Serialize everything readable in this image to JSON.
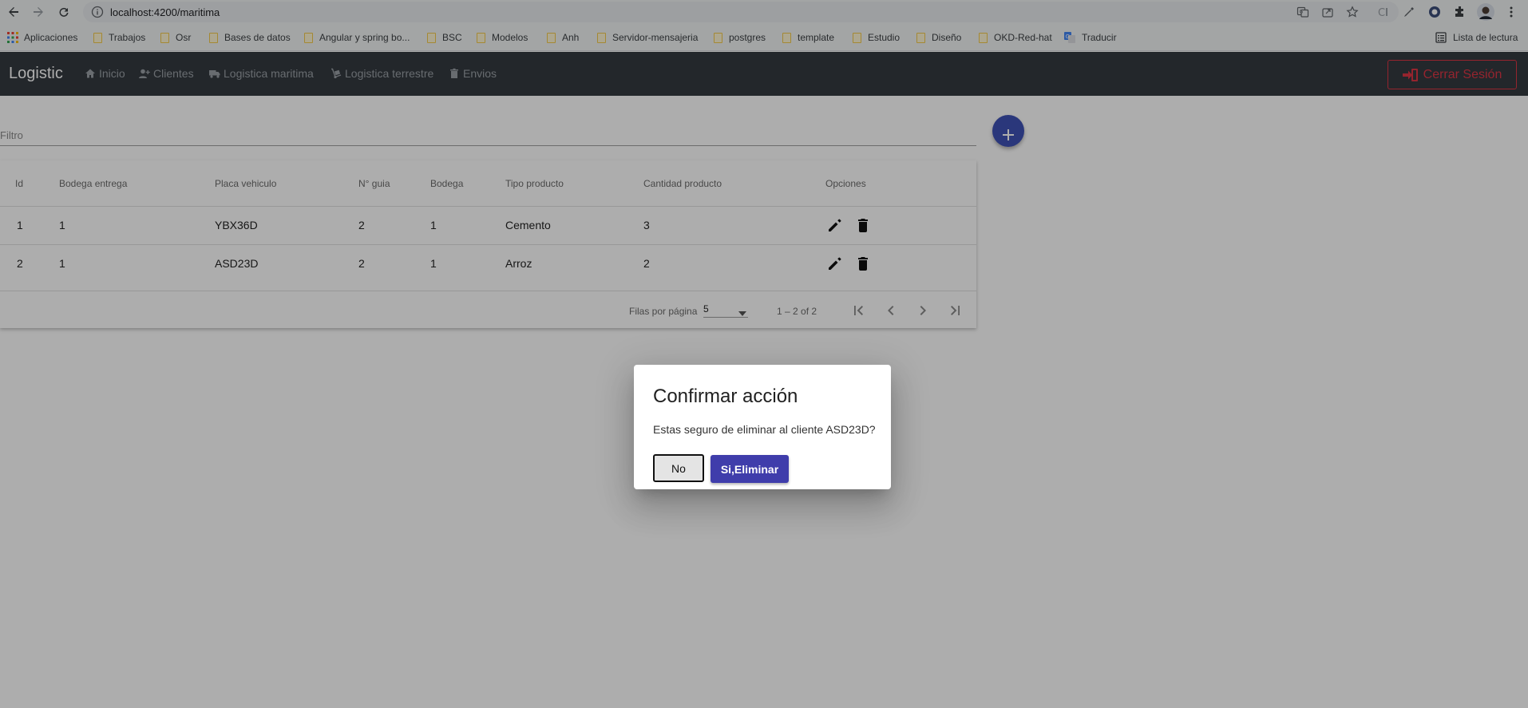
{
  "browser": {
    "url": "localhost:4200/maritima",
    "bookmarks": {
      "apps": "Aplicaciones",
      "items": [
        "Trabajos",
        "Osr",
        "Bases de datos",
        "Angular y spring bo...",
        "BSC",
        "Modelos",
        "Anh",
        "Servidor-mensajeria",
        "postgres",
        "template",
        "Estudio",
        "Diseño",
        "OKD-Red-hat"
      ],
      "translate": "Traducir",
      "reading_list": "Lista de lectura"
    }
  },
  "app": {
    "brand": "Logistic",
    "nav": [
      "Inicio",
      "Clientes",
      "Logistica maritima",
      "Logistica terrestre",
      "Envios"
    ],
    "logout": "Cerrar Sesión",
    "accent_color": "#3f51b5",
    "danger_color": "#dc3545"
  },
  "filter": {
    "label": "Filtro"
  },
  "table": {
    "columns": [
      "Id",
      "Bodega entrega",
      "Placa vehiculo",
      "N° guia",
      "Bodega",
      "Tipo producto",
      "Cantidad producto",
      "Opciones"
    ],
    "rows": [
      [
        "1",
        "1",
        "YBX36D",
        "2",
        "1",
        "Cemento",
        "3"
      ],
      [
        "2",
        "1",
        "ASD23D",
        "2",
        "1",
        "Arroz",
        "2"
      ]
    ],
    "row_icons": [
      "edit-icon",
      "delete-icon"
    ]
  },
  "paginator": {
    "rows_label": "Filas por página",
    "page_size": "5",
    "range": "1 – 2 of 2"
  },
  "dialog": {
    "title": "Confirmar acción",
    "message": "Estas seguro de eliminar al cliente ASD23D?",
    "no": "No",
    "yes": "Si,Eliminar"
  }
}
